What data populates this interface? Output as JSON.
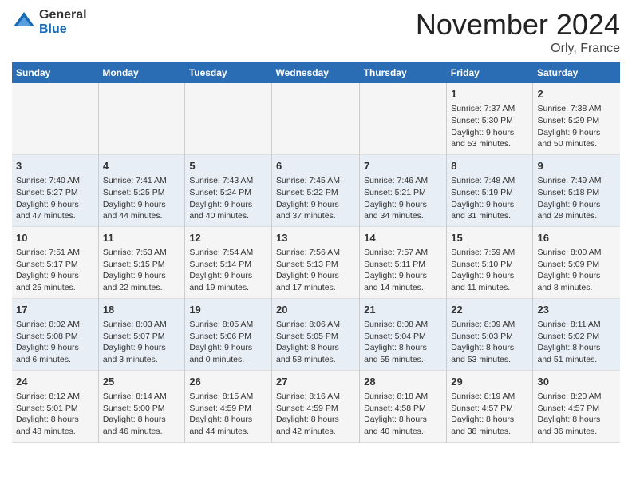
{
  "header": {
    "logo": {
      "general": "General",
      "blue": "Blue"
    },
    "title": "November 2024",
    "location": "Orly, France"
  },
  "days_of_week": [
    "Sunday",
    "Monday",
    "Tuesday",
    "Wednesday",
    "Thursday",
    "Friday",
    "Saturday"
  ],
  "weeks": [
    {
      "cells": [
        {
          "day": null,
          "info": ""
        },
        {
          "day": null,
          "info": ""
        },
        {
          "day": null,
          "info": ""
        },
        {
          "day": null,
          "info": ""
        },
        {
          "day": null,
          "info": ""
        },
        {
          "day": "1",
          "info": "Sunrise: 7:37 AM\nSunset: 5:30 PM\nDaylight: 9 hours and 53 minutes."
        },
        {
          "day": "2",
          "info": "Sunrise: 7:38 AM\nSunset: 5:29 PM\nDaylight: 9 hours and 50 minutes."
        }
      ]
    },
    {
      "cells": [
        {
          "day": "3",
          "info": "Sunrise: 7:40 AM\nSunset: 5:27 PM\nDaylight: 9 hours and 47 minutes."
        },
        {
          "day": "4",
          "info": "Sunrise: 7:41 AM\nSunset: 5:25 PM\nDaylight: 9 hours and 44 minutes."
        },
        {
          "day": "5",
          "info": "Sunrise: 7:43 AM\nSunset: 5:24 PM\nDaylight: 9 hours and 40 minutes."
        },
        {
          "day": "6",
          "info": "Sunrise: 7:45 AM\nSunset: 5:22 PM\nDaylight: 9 hours and 37 minutes."
        },
        {
          "day": "7",
          "info": "Sunrise: 7:46 AM\nSunset: 5:21 PM\nDaylight: 9 hours and 34 minutes."
        },
        {
          "day": "8",
          "info": "Sunrise: 7:48 AM\nSunset: 5:19 PM\nDaylight: 9 hours and 31 minutes."
        },
        {
          "day": "9",
          "info": "Sunrise: 7:49 AM\nSunset: 5:18 PM\nDaylight: 9 hours and 28 minutes."
        }
      ]
    },
    {
      "cells": [
        {
          "day": "10",
          "info": "Sunrise: 7:51 AM\nSunset: 5:17 PM\nDaylight: 9 hours and 25 minutes."
        },
        {
          "day": "11",
          "info": "Sunrise: 7:53 AM\nSunset: 5:15 PM\nDaylight: 9 hours and 22 minutes."
        },
        {
          "day": "12",
          "info": "Sunrise: 7:54 AM\nSunset: 5:14 PM\nDaylight: 9 hours and 19 minutes."
        },
        {
          "day": "13",
          "info": "Sunrise: 7:56 AM\nSunset: 5:13 PM\nDaylight: 9 hours and 17 minutes."
        },
        {
          "day": "14",
          "info": "Sunrise: 7:57 AM\nSunset: 5:11 PM\nDaylight: 9 hours and 14 minutes."
        },
        {
          "day": "15",
          "info": "Sunrise: 7:59 AM\nSunset: 5:10 PM\nDaylight: 9 hours and 11 minutes."
        },
        {
          "day": "16",
          "info": "Sunrise: 8:00 AM\nSunset: 5:09 PM\nDaylight: 9 hours and 8 minutes."
        }
      ]
    },
    {
      "cells": [
        {
          "day": "17",
          "info": "Sunrise: 8:02 AM\nSunset: 5:08 PM\nDaylight: 9 hours and 6 minutes."
        },
        {
          "day": "18",
          "info": "Sunrise: 8:03 AM\nSunset: 5:07 PM\nDaylight: 9 hours and 3 minutes."
        },
        {
          "day": "19",
          "info": "Sunrise: 8:05 AM\nSunset: 5:06 PM\nDaylight: 9 hours and 0 minutes."
        },
        {
          "day": "20",
          "info": "Sunrise: 8:06 AM\nSunset: 5:05 PM\nDaylight: 8 hours and 58 minutes."
        },
        {
          "day": "21",
          "info": "Sunrise: 8:08 AM\nSunset: 5:04 PM\nDaylight: 8 hours and 55 minutes."
        },
        {
          "day": "22",
          "info": "Sunrise: 8:09 AM\nSunset: 5:03 PM\nDaylight: 8 hours and 53 minutes."
        },
        {
          "day": "23",
          "info": "Sunrise: 8:11 AM\nSunset: 5:02 PM\nDaylight: 8 hours and 51 minutes."
        }
      ]
    },
    {
      "cells": [
        {
          "day": "24",
          "info": "Sunrise: 8:12 AM\nSunset: 5:01 PM\nDaylight: 8 hours and 48 minutes."
        },
        {
          "day": "25",
          "info": "Sunrise: 8:14 AM\nSunset: 5:00 PM\nDaylight: 8 hours and 46 minutes."
        },
        {
          "day": "26",
          "info": "Sunrise: 8:15 AM\nSunset: 4:59 PM\nDaylight: 8 hours and 44 minutes."
        },
        {
          "day": "27",
          "info": "Sunrise: 8:16 AM\nSunset: 4:59 PM\nDaylight: 8 hours and 42 minutes."
        },
        {
          "day": "28",
          "info": "Sunrise: 8:18 AM\nSunset: 4:58 PM\nDaylight: 8 hours and 40 minutes."
        },
        {
          "day": "29",
          "info": "Sunrise: 8:19 AM\nSunset: 4:57 PM\nDaylight: 8 hours and 38 minutes."
        },
        {
          "day": "30",
          "info": "Sunrise: 8:20 AM\nSunset: 4:57 PM\nDaylight: 8 hours and 36 minutes."
        }
      ]
    }
  ]
}
